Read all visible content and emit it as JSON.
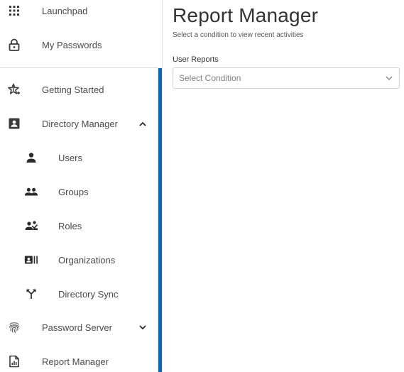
{
  "sidebar": {
    "items": [
      {
        "label": "Launchpad",
        "icon": "grid-icon"
      },
      {
        "label": "My Passwords",
        "icon": "lock-icon"
      },
      {
        "label": "Getting Started",
        "icon": "star-sparkle-icon"
      },
      {
        "label": "Directory Manager",
        "icon": "contact-card-icon",
        "expanded": true
      },
      {
        "label": "Users",
        "icon": "person-icon"
      },
      {
        "label": "Groups",
        "icon": "group-icon"
      },
      {
        "label": "Roles",
        "icon": "roles-icon"
      },
      {
        "label": "Organizations",
        "icon": "organization-icon"
      },
      {
        "label": "Directory Sync",
        "icon": "sync-merge-icon"
      },
      {
        "label": "Password Server",
        "icon": "fingerprint-icon",
        "expanded": false
      },
      {
        "label": "Report Manager",
        "icon": "report-icon"
      }
    ]
  },
  "main": {
    "title": "Report Manager",
    "subtitle": "Select a condition to view recent activities",
    "field_label": "User Reports",
    "select_placeholder": "Select Condition"
  },
  "colors": {
    "accent": "#0a66b2",
    "text": "#4a4a4a",
    "icon": "#3a3a3a"
  }
}
